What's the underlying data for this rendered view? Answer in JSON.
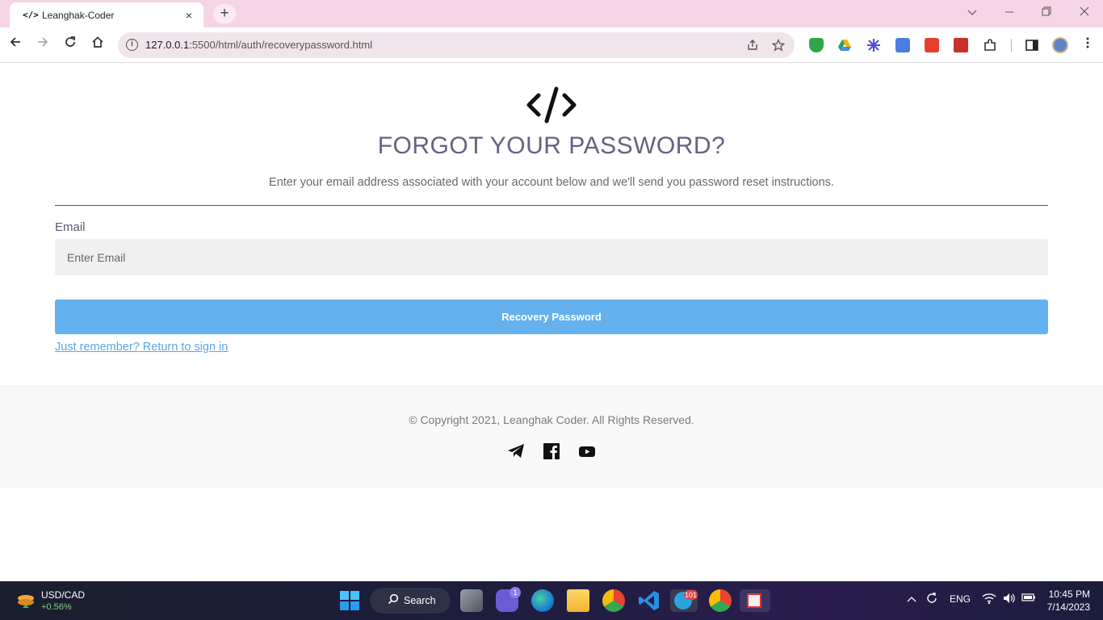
{
  "browser": {
    "tab": {
      "favicon": "</>",
      "title": "Leanghak-Coder",
      "close_icon": "×"
    },
    "new_tab_icon": "+",
    "address": {
      "host": "127.0.0.1",
      "path": ":5500/html/auth/recoverypassword.html"
    },
    "extensions": [
      "shield-extension-icon",
      "google-drive-icon",
      "extension-flower-icon",
      "google-translate-icon",
      "todoist-icon",
      "bookmark-extension-icon",
      "puzzle-icon"
    ]
  },
  "page": {
    "logo_icon": "code-icon",
    "title": "FORGOT YOUR PASSWORD?",
    "description": "Enter your email address associated with your account below and we'll send you password reset instructions.",
    "email_label": "Email",
    "email_placeholder": "Enter Email",
    "submit_label": "Recovery Password",
    "return_link": "Just remember? Return to sign in",
    "colors": {
      "title": "#636285",
      "button": "#64b1ee",
      "link": "#5aa6e6"
    }
  },
  "footer": {
    "copyright": "© Copyright 2021, Leanghak Coder. All Rights Reserved.",
    "social": [
      "telegram-icon",
      "facebook-icon",
      "youtube-icon"
    ]
  },
  "taskbar": {
    "widget": {
      "name": "USD/CAD",
      "change": "+0.56%"
    },
    "search_label": "Search",
    "teams_badge": "1",
    "telegram_badge": "101",
    "language": "ENG",
    "time": "10:45 PM",
    "date": "7/14/2023"
  }
}
